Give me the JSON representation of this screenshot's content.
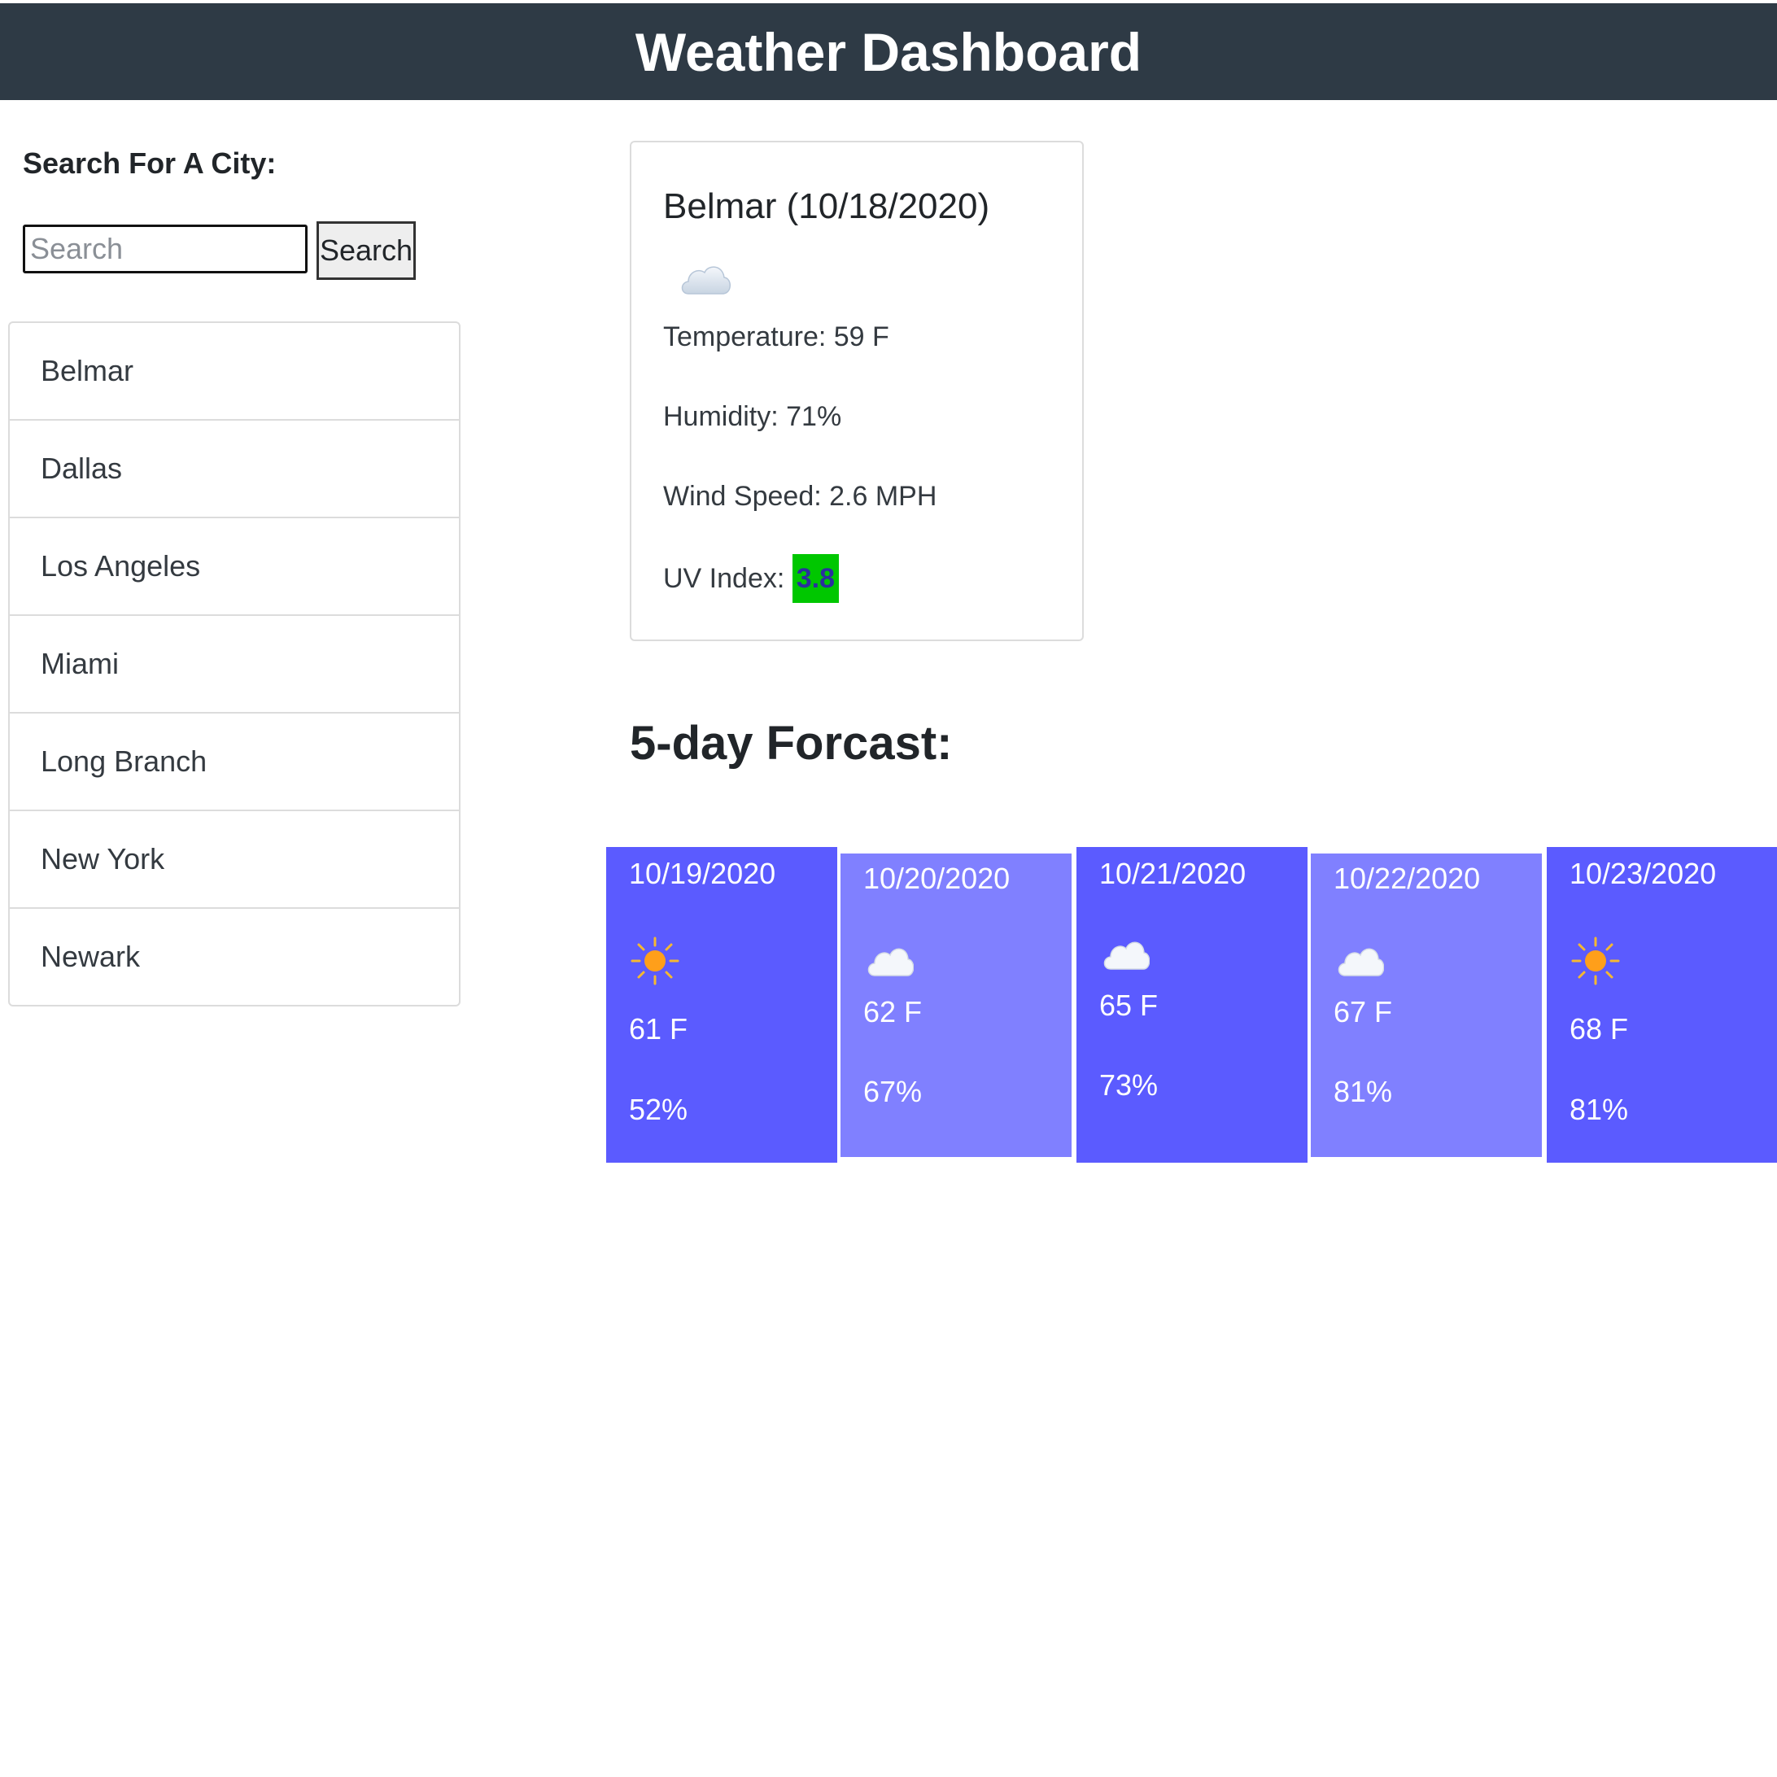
{
  "header": {
    "title": "Weather Dashboard"
  },
  "search": {
    "label": "Search For A City:",
    "placeholder": "Search",
    "button_label": "Search"
  },
  "cities": [
    "Belmar",
    "Dallas",
    "Los Angeles",
    "Miami",
    "Long Branch",
    "New York",
    "Newark"
  ],
  "current": {
    "title": "Belmar (10/18/2020)",
    "icon": "cloud-icon",
    "temperature": "Temperature: 59 F",
    "humidity": "Humidity: 71%",
    "wind": "Wind Speed: 2.6 MPH",
    "uv_label": "UV Index: ",
    "uv_value": "3.8",
    "uv_color": "#00c700"
  },
  "forecast": {
    "title": "5-day Forcast:",
    "colors": {
      "dark": "#5b5bff",
      "light": "#8080ff"
    },
    "days": [
      {
        "date": "10/19/2020",
        "icon": "sun-icon",
        "temp": "61 F",
        "humidity": "52%"
      },
      {
        "date": "10/20/2020",
        "icon": "cloud-icon",
        "temp": "62 F",
        "humidity": "67%"
      },
      {
        "date": "10/21/2020",
        "icon": "cloud-icon",
        "temp": "65 F",
        "humidity": "73%"
      },
      {
        "date": "10/22/2020",
        "icon": "cloud-icon",
        "temp": "67 F",
        "humidity": "81%"
      },
      {
        "date": "10/23/2020",
        "icon": "sun-icon",
        "temp": "68 F",
        "humidity": "81%"
      }
    ]
  }
}
